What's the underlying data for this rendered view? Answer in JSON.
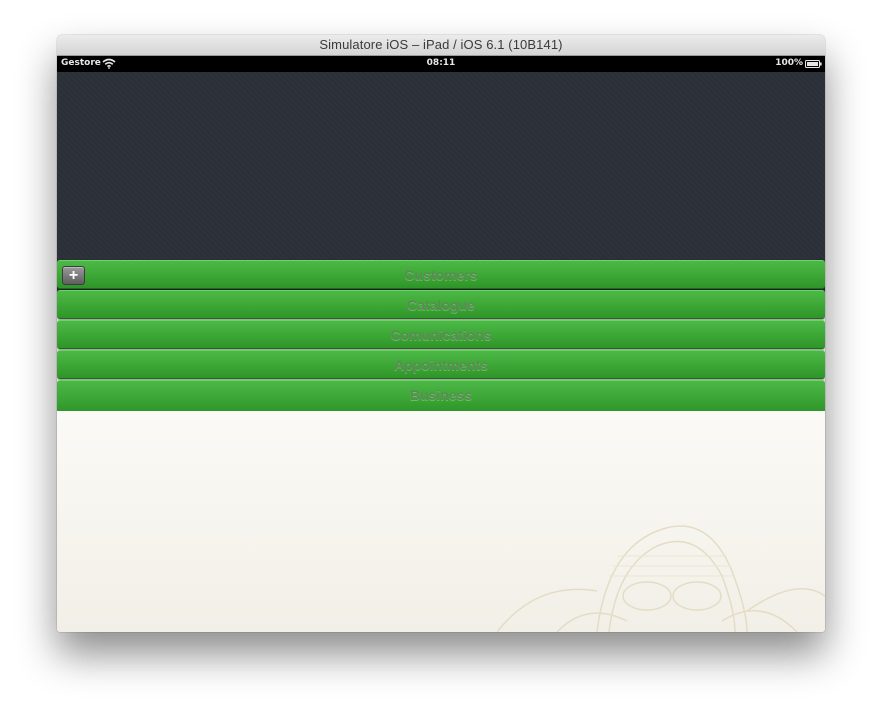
{
  "window": {
    "title": "Simulatore iOS – iPad / iOS 6.1 (10B141)"
  },
  "status_bar": {
    "carrier": "Gestore",
    "time": "08:11",
    "battery": "100%",
    "icons": [
      "wifi-icon",
      "battery-icon"
    ]
  },
  "menu": {
    "items": [
      {
        "label": "Customers"
      },
      {
        "label": "Catalogue"
      },
      {
        "label": "Comunications"
      },
      {
        "label": "Appointments"
      },
      {
        "label": "Business"
      }
    ],
    "add_button": {
      "symbol": "+"
    }
  },
  "colors": {
    "header_bg": "#2c3038",
    "menu_green": "#3faa38",
    "menu_label": "#5b8a57",
    "content_bg": "#f6f4ee"
  }
}
